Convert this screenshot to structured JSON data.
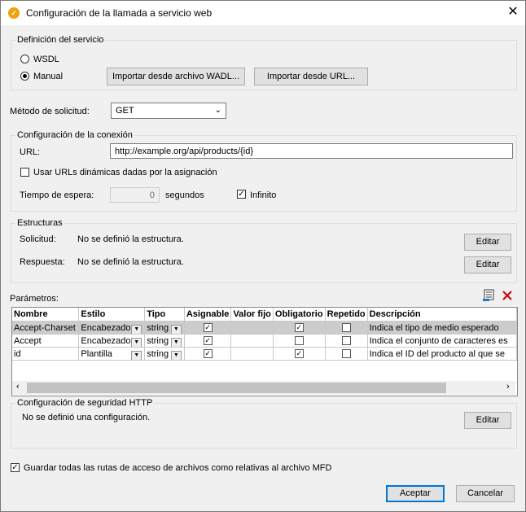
{
  "window": {
    "title": "Configuración de la llamada a servicio web"
  },
  "service_definition": {
    "group_label": "Definición del servicio",
    "wsdl_label": "WSDL",
    "manual_label": "Manual",
    "import_wadl_label": "Importar desde archivo WADL...",
    "import_url_label": "Importar desde URL..."
  },
  "request_method": {
    "label": "Método de solicitud:",
    "value": "GET"
  },
  "connection": {
    "group_label": "Configuración de la conexión",
    "url_label": "URL:",
    "url_value": "http://example.org/api/products/{id}",
    "dynamic_label": "Usar URLs dinámicas dadas por la asignación",
    "timeout_label": "Tiempo de espera:",
    "timeout_value": "0",
    "seconds_label": "segundos",
    "infinite_label": "Infinito"
  },
  "structures": {
    "group_label": "Estructuras",
    "request_label": "Solicitud:",
    "request_value": "No se definió la estructura.",
    "response_label": "Respuesta:",
    "response_value": "No se definió la estructura.",
    "edit_label": "Editar"
  },
  "parameters": {
    "label": "Parámetros:",
    "columns": [
      "Nombre",
      "Estilo",
      "Tipo",
      "Asignable",
      "Valor fijo",
      "Obligatorio",
      "Repetido",
      "Descripción"
    ],
    "rows": [
      {
        "name": "Accept-Charset",
        "style": "Encabezado",
        "type": "string",
        "assignable": true,
        "fixed": "",
        "required": true,
        "repeated": false,
        "description": "Indica el tipo de medio esperado"
      },
      {
        "name": "Accept",
        "style": "Encabezado",
        "type": "string",
        "assignable": true,
        "fixed": "",
        "required": false,
        "repeated": false,
        "description": "Indica el conjunto de caracteres es"
      },
      {
        "name": "id",
        "style": "Plantilla",
        "type": "string",
        "assignable": true,
        "fixed": "",
        "required": true,
        "repeated": false,
        "description": "Indica el ID del producto al que se"
      }
    ]
  },
  "security": {
    "group_label": "Configuración de seguridad HTTP",
    "value": "No se definió una configuración.",
    "edit_label": "Editar"
  },
  "save_relative_label": "Guardar todas las rutas de acceso de archivos como relativas al archivo MFD",
  "footer": {
    "accept_label": "Aceptar",
    "cancel_label": "Cancelar"
  },
  "colors": {
    "accent": "#0078d7",
    "delete_icon": "#cc0000"
  }
}
